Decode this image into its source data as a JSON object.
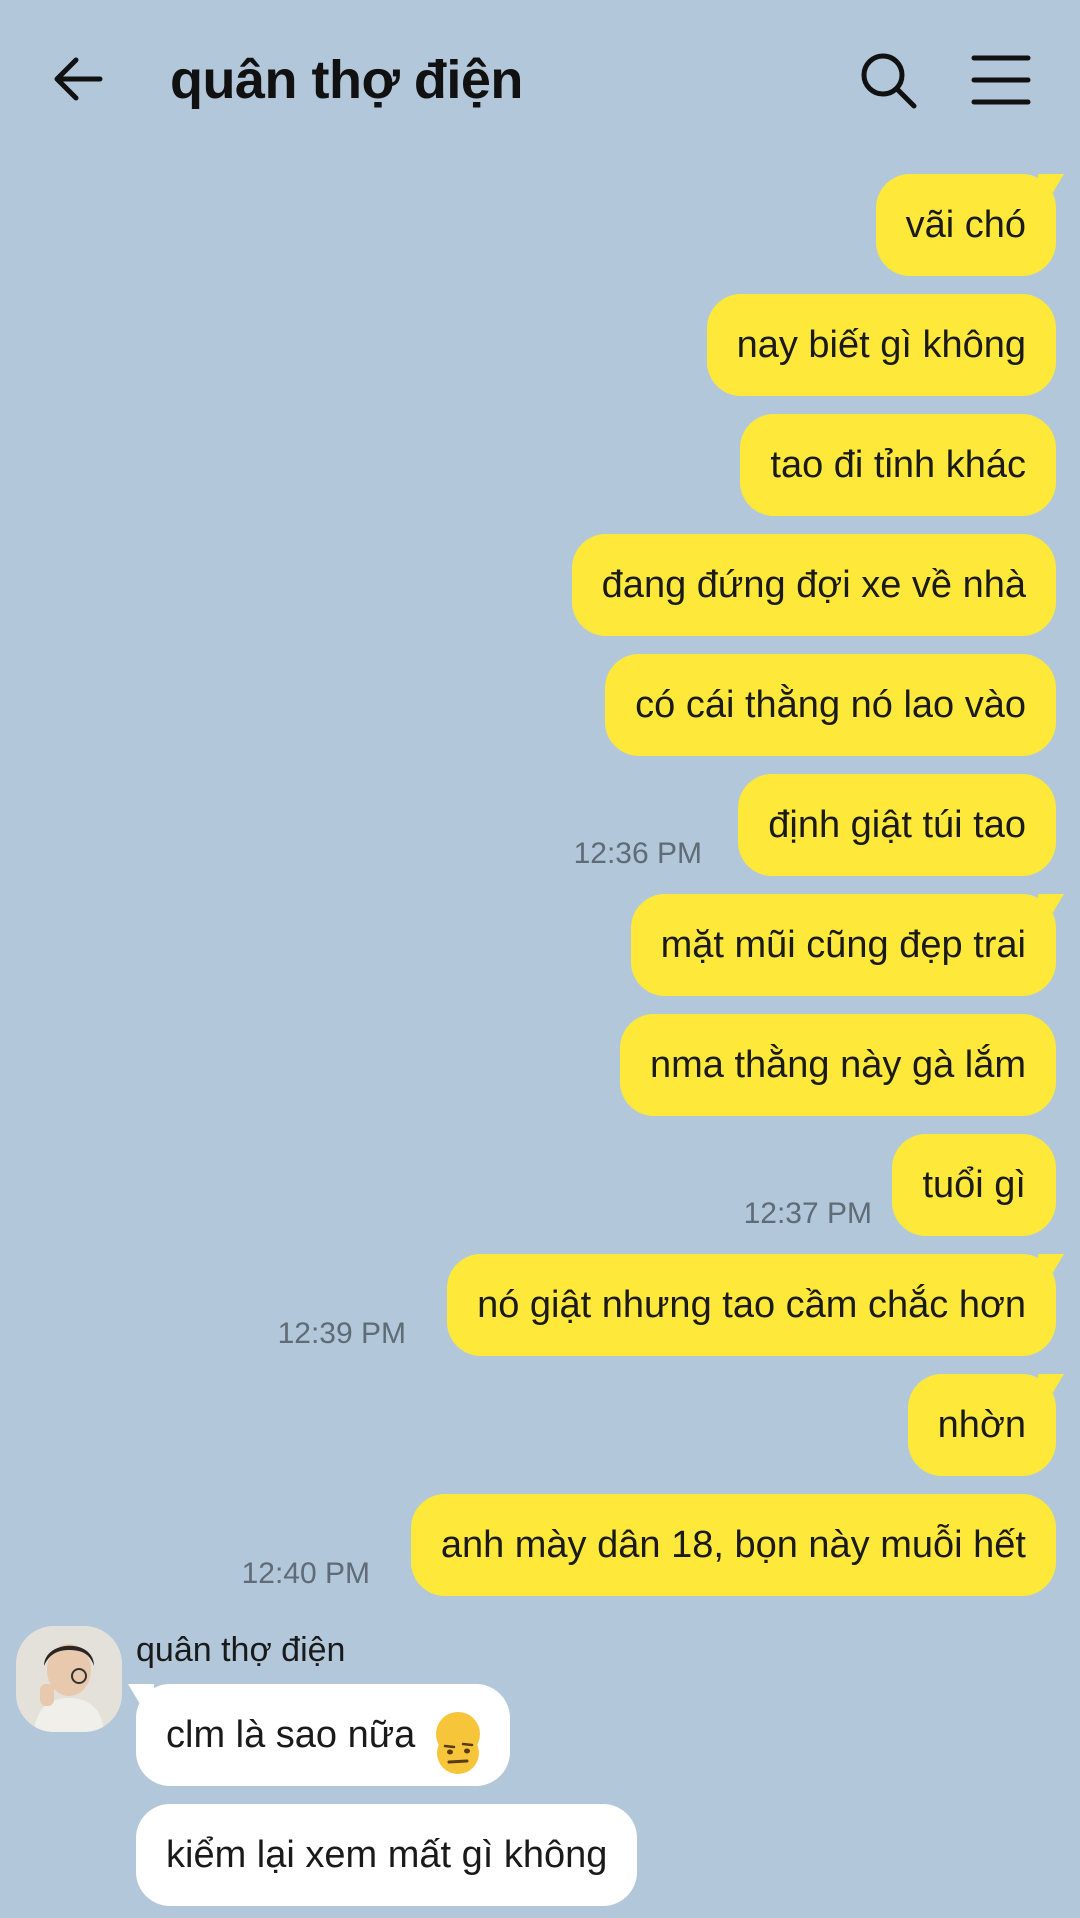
{
  "header": {
    "title": "quân thợ điện",
    "back_icon": "arrow-left-icon",
    "search_icon": "search-icon",
    "menu_icon": "hamburger-menu-icon"
  },
  "colors": {
    "background": "#b2c7da",
    "outgoing_bubble": "#fee93a",
    "incoming_bubble": "#ffffff",
    "timestamp": "#5f6b76"
  },
  "outgoing": [
    {
      "text": "vãi chó",
      "time": ""
    },
    {
      "text": "nay biết gì không",
      "time": ""
    },
    {
      "text": "tao đi tỉnh khác",
      "time": ""
    },
    {
      "text": "đang đứng đợi xe về nhà",
      "time": ""
    },
    {
      "text": "có cái thằng nó lao vào",
      "time": ""
    },
    {
      "text": "định giật túi tao",
      "time": "12:36 PM"
    },
    {
      "text": "mặt mũi cũng đẹp trai",
      "time": ""
    },
    {
      "text": "nma thằng này gà lắm",
      "time": ""
    },
    {
      "text": "tuổi gì",
      "time": "12:37 PM"
    },
    {
      "text": "nó giật nhưng tao cầm chắc hơn",
      "time": "12:39 PM"
    },
    {
      "text": "nhờn",
      "time": ""
    },
    {
      "text": "anh mày dân 18, bọn này muỗi hết",
      "time": "12:40 PM"
    }
  ],
  "incoming": {
    "sender": "quân thợ điện",
    "avatar": "avatar-photo",
    "messages": [
      {
        "text": "clm là sao nữa",
        "emoji": "unamused-face-emoji"
      },
      {
        "text": "kiểm lại xem mất gì không",
        "emoji": ""
      }
    ]
  }
}
